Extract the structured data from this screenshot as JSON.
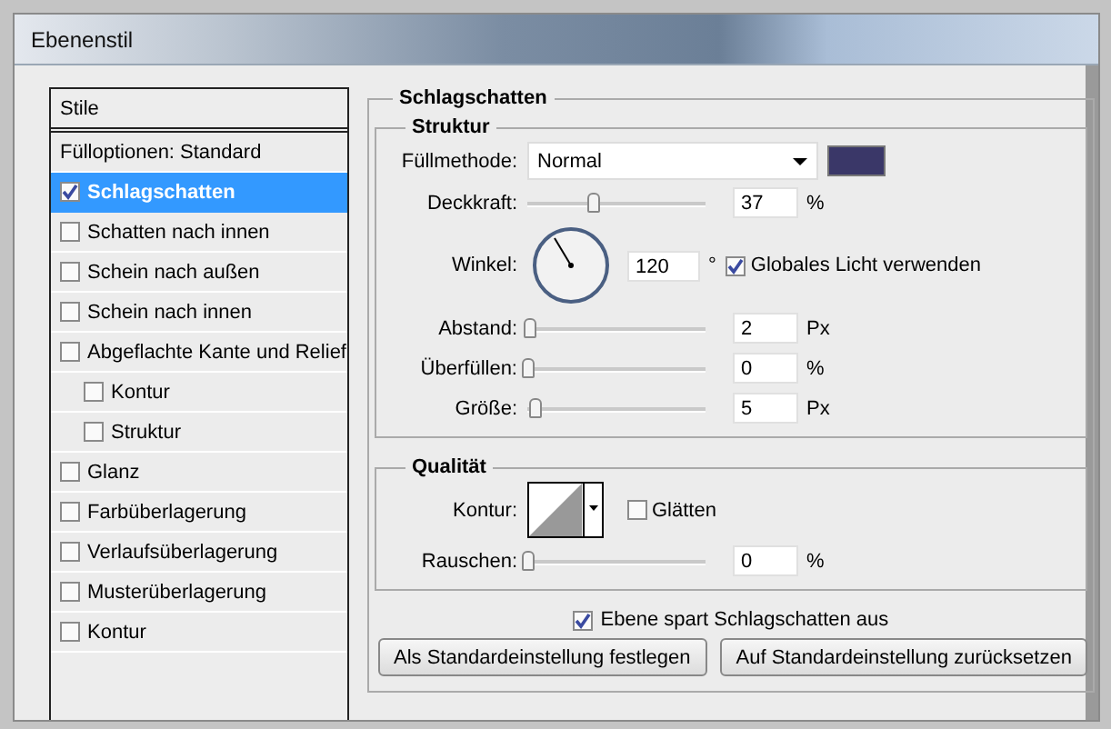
{
  "window": {
    "title": "Ebenenstil"
  },
  "styles_list": {
    "header": "Stile",
    "items": [
      {
        "kind": "plain",
        "label": "Fülloptionen: Standard",
        "selected": false
      },
      {
        "kind": "checkbox",
        "label": "Schlagschatten",
        "checked": true,
        "selected": true
      },
      {
        "kind": "checkbox",
        "label": "Schatten nach innen",
        "checked": false,
        "selected": false
      },
      {
        "kind": "checkbox",
        "label": "Schein nach außen",
        "checked": false,
        "selected": false
      },
      {
        "kind": "checkbox",
        "label": "Schein nach innen",
        "checked": false,
        "selected": false
      },
      {
        "kind": "checkbox",
        "label": "Abgeflachte Kante und Relief",
        "checked": false,
        "selected": false,
        "children": [
          {
            "kind": "checkbox",
            "label": "Kontur",
            "checked": false,
            "selected": false
          },
          {
            "kind": "checkbox",
            "label": "Struktur",
            "checked": false,
            "selected": false
          }
        ]
      },
      {
        "kind": "checkbox",
        "label": "Glanz",
        "checked": false,
        "selected": false
      },
      {
        "kind": "checkbox",
        "label": "Farbüberlagerung",
        "checked": false,
        "selected": false
      },
      {
        "kind": "checkbox",
        "label": "Verlaufsüberlagerung",
        "checked": false,
        "selected": false
      },
      {
        "kind": "checkbox",
        "label": "Musterüberlagerung",
        "checked": false,
        "selected": false
      },
      {
        "kind": "checkbox",
        "label": "Kontur",
        "checked": false,
        "selected": false
      }
    ]
  },
  "panel": {
    "title": "Schlagschatten",
    "groups": [
      {
        "title": "Struktur",
        "rows": [
          {
            "kind": "select",
            "label": "Füllmethode:",
            "value": "Normal",
            "color": "#3a3768"
          },
          {
            "kind": "slider",
            "label": "Deckkraft:",
            "level": 0.37,
            "value": "37",
            "unit": "%"
          },
          {
            "kind": "angle",
            "label": "Winkel:",
            "value": "120",
            "unit": "°",
            "option": {
              "label": "Globales Licht verwenden",
              "checked": true
            }
          },
          {
            "kind": "slider",
            "label": "Abstand:",
            "level": 0.02,
            "value": "2",
            "unit": "Px"
          },
          {
            "kind": "slider",
            "label": "Überfüllen:",
            "level": 0,
            "value": "0",
            "unit": "%"
          },
          {
            "kind": "slider",
            "label": "Größe:",
            "level": 0.05,
            "value": "5",
            "unit": "Px"
          }
        ]
      },
      {
        "title": "Qualität",
        "rows": [
          {
            "kind": "contour",
            "label": "Kontur:",
            "option": {
              "label": "Glätten",
              "checked": false
            }
          },
          {
            "kind": "slider",
            "label": "Rauschen:",
            "level": 0,
            "value": "0",
            "unit": "%"
          }
        ]
      }
    ],
    "knockout": {
      "label": "Ebene spart Schlagschatten aus",
      "checked": true
    },
    "buttons": [
      "Als Standardeinstellung festlegen",
      "Auf Standardeinstellung zurücksetzen"
    ]
  }
}
